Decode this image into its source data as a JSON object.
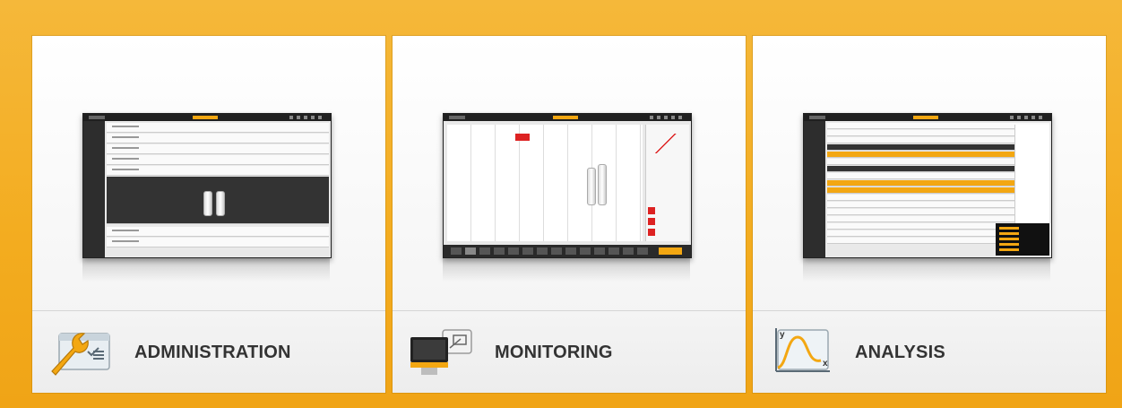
{
  "colors": {
    "accent": "#f3a712",
    "background": "#f3ac1f",
    "text": "#333333"
  },
  "cards": [
    {
      "label": "ADMINISTRATION",
      "icon": "admin-wrench-icon"
    },
    {
      "label": "MONITORING",
      "icon": "monitor-display-icon"
    },
    {
      "label": "ANALYSIS",
      "icon": "chart-curve-icon"
    }
  ]
}
